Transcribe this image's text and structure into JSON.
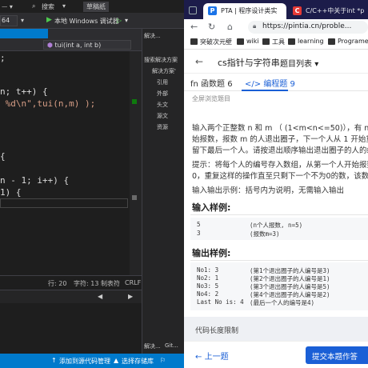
{
  "vs": {
    "menu": {
      "search": "搜索",
      "project_name": "草稿纸"
    },
    "toolbar": {
      "run_label": "本地 Windows 调试器",
      "platform_fragment": "64"
    },
    "navbar": {
      "function_dropdown": "tui(int a, int b)"
    },
    "code_lines": [
      ";",
      "n; t++) {",
      " %d\\n\",tui(n,m) );",
      "{",
      "n - 1; i++) {",
      "1) {"
    ],
    "statusline": {
      "row": "行: 20",
      "char": "字符: 13",
      "tab": "制表符",
      "eol": "CRLF"
    },
    "solution_explorer": {
      "search": "搜索解决方案",
      "items": [
        "解决方案'",
        "引用",
        "外部",
        "头文",
        "源文",
        "资源"
      ],
      "bottom_tabs": [
        "解决...",
        "Git..."
      ],
      "top_tab": "解决..."
    },
    "statusbar": {
      "source_control": "添加到源代码管理",
      "repo": "选择存储库"
    }
  },
  "browser": {
    "tabs": [
      {
        "title": "PTA | 程序设计类实",
        "favicon": "P",
        "color": "#1a73e8",
        "active": true
      },
      {
        "title": "C/C++中关于int *p",
        "favicon": "C",
        "color": "#e53935",
        "active": false
      }
    ],
    "url": "https://pintia.cn/proble...",
    "bookmarks": [
      "突破次元壁",
      "wiki",
      "工具",
      "learning",
      "Programe"
    ],
    "header": {
      "problem_set": "cs指针与字符串",
      "problem_list": "题目列表"
    },
    "tabs_row": {
      "function_label": "函数题",
      "function_count": "6",
      "program_label": "编程题",
      "program_count": "9"
    },
    "content": {
      "browse_link": "全屏浏览题目",
      "desc_lines": [
        "输入两个正整数 n 和 m （ (1<m<n<=50)），有 n 个人围",
        "始报数，报数 m 的人退出圈子，下一个人从 1 开始重新",
        "留下最后一个人。请按退出顺序输出退出圈子的人的编号",
        "提示：将每个人的编号存入数组，从第一个人开始报数，",
        "0，重复这样的操作直至只剩下一个不为0的数，该数就是",
        "输入输出示例：括号内为说明，无需输入输出"
      ],
      "input_heading": "输入样例:",
      "input_rows": [
        {
          "value": "5",
          "note": "(n个人报数, n=5)"
        },
        {
          "value": "3",
          "note": "(报数m=3)"
        }
      ],
      "output_heading": "输出样例:",
      "output_rows": [
        {
          "value": "No1: 3",
          "note": "(第1个退出圈子的人编号是3)"
        },
        {
          "value": "No2: 1",
          "note": "(第2个退出圈子的人编号是1)"
        },
        {
          "value": "No3: 5",
          "note": "(第3个退出圈子的人编号是5)"
        },
        {
          "value": "No4: 2",
          "note": "(第4个退出圈子的人编号是2)"
        },
        {
          "value": "Last No is: 4",
          "note": "(最后一个人的编号是4)"
        }
      ],
      "code_limit": "代码长度限制",
      "prev_button": "上一题",
      "submit_button": "提交本题作答"
    }
  }
}
